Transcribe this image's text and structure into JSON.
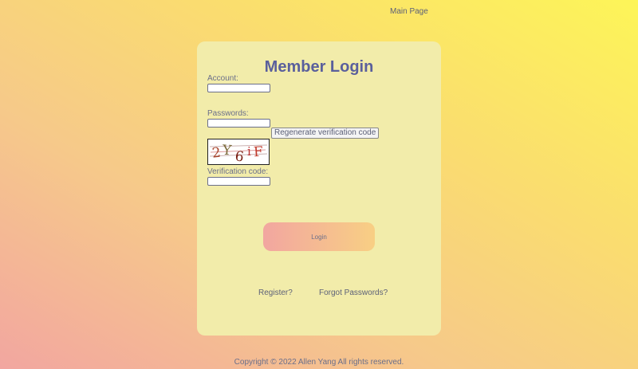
{
  "nav": {
    "main_page": "Main Page"
  },
  "login": {
    "title": "Member Login",
    "account_label": "Account:",
    "account_value": "",
    "password_label": "Passwords:",
    "password_value": "",
    "regenerate_label": "Regenerate verification code",
    "captcha_text": "2Y6iF",
    "verification_label": "Verification code:",
    "verification_value": "",
    "login_button": "Login",
    "register_link": "Register?",
    "forgot_link": "Forgot Passwords?"
  },
  "footer": {
    "copyright": "Copyright © 2022 Allen Yang All rights reserved."
  },
  "colors": {
    "card_background": "#f2ecaa",
    "title": "#5a5f9c",
    "gradient_start": "#f2a6a0",
    "gradient_end": "#fdf558"
  }
}
